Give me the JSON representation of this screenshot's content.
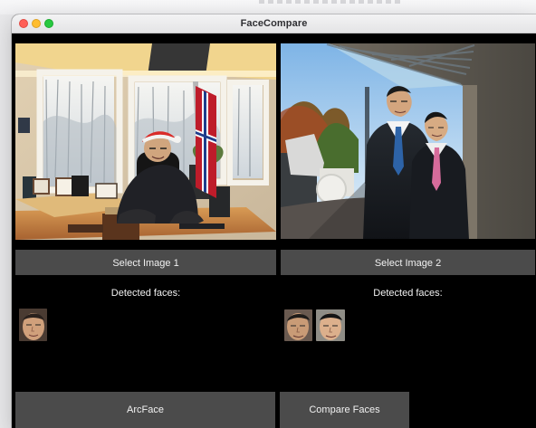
{
  "window": {
    "title": "FaceCompare"
  },
  "image_panels": {
    "left": {
      "button_label": "Select Image 1",
      "faces_label": "Detected faces:"
    },
    "right": {
      "button_label": "Select Image 2",
      "faces_label": "Detected faces:"
    }
  },
  "detected_faces": {
    "left_count": 1,
    "right_count": 2
  },
  "actions": {
    "model_label": "ArcFace",
    "compare_label": "Compare Faces"
  },
  "colors": {
    "background": "#000000",
    "button": "#4b4b4b",
    "button_text": "#f1f1f1",
    "title_text": "#2f2f33",
    "traffic_red": "#ff5f57",
    "traffic_yellow": "#ffbd2e",
    "traffic_green": "#28c840"
  }
}
